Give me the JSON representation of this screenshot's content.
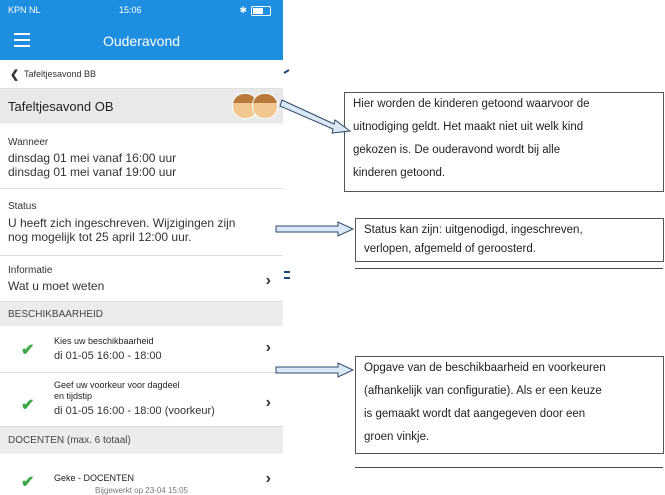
{
  "status_bar": {
    "carrier": "KPN NL",
    "time": "15:06"
  },
  "navbar": {
    "title": "Ouderavond"
  },
  "breadcrumb": {
    "label": "Tafeltjesavond BB"
  },
  "event": {
    "title": "Tafeltjesavond OB"
  },
  "wanneer": {
    "label": "Wanneer",
    "line1": "dinsdag 01 mei vanaf 16:00 uur",
    "line2": "dinsdag 01 mei vanaf 19:00 uur"
  },
  "status": {
    "label": "Status",
    "line1": "U heeft zich ingeschreven. Wijzigingen zijn",
    "line2": "nog mogelijk tot 25 april 12:00 uur."
  },
  "informatie": {
    "label": "Informatie",
    "value": "Wat u moet weten"
  },
  "beschikbaarheid": {
    "header": "BESCHIKBAARHEID",
    "item1": {
      "title": "Kies uw beschikbaarheid",
      "sub": "di 01-05 16:00 - 18:00"
    },
    "item2": {
      "title1": "Geef uw voorkeur voor dagdeel",
      "title2": "en tijdstip",
      "sub": "di 01-05 16:00 - 18:00 (voorkeur)"
    }
  },
  "docenten": {
    "header": "DOCENTEN (max. 6 totaal)",
    "item": "Geke - DOCENTEN"
  },
  "footer": "Bijgewerkt op 23-04 15:05",
  "annotations": {
    "a1": {
      "l1": "Hier worden de kinderen getoond waarvoor de",
      "l2": "uitnodiging geldt. Het maakt niet uit welk kind",
      "l3": "gekozen is. De ouderavond wordt bij alle",
      "l4": "kinderen getoond."
    },
    "a2": {
      "l1": "Status kan zijn: uitgenodigd, ingeschreven,",
      "l2": "verlopen, afgemeld of geroosterd."
    },
    "a3": {
      "l1": "Opgave van de beschikbaarheid en voorkeuren",
      "l2": "(afhankelijk van configuratie). Als er een keuze",
      "l3": "is gemaakt wordt dat aangegeven door een",
      "l4": "groen vinkje."
    }
  },
  "colors": {
    "brand": "#1e8fe0",
    "check": "#3aa845"
  }
}
